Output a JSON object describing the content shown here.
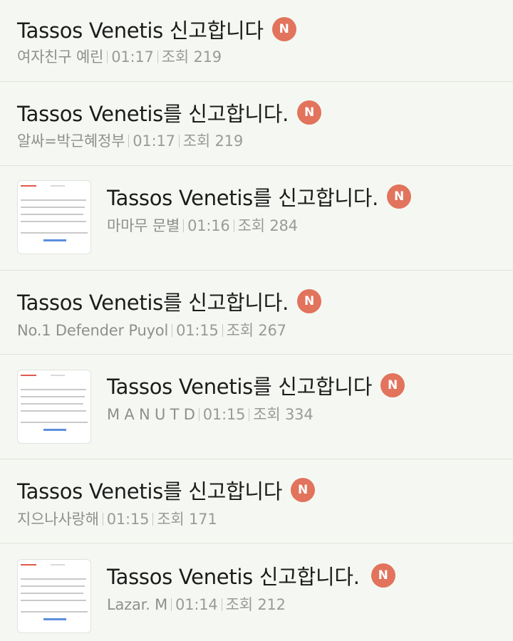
{
  "posts": [
    {
      "title": "Tassos Venetis 신고합니다",
      "badge": "N",
      "author": "여자친구 예린",
      "time": "01:17",
      "views_label": "조회",
      "views": "219",
      "has_thumbnail": false
    },
    {
      "title": "Tassos Venetis를 신고합니다.",
      "badge": "N",
      "author": "알싸=박근혜정부",
      "time": "01:17",
      "views_label": "조회",
      "views": "219",
      "has_thumbnail": false
    },
    {
      "title": "Tassos Venetis를 신고합니다.",
      "badge": "N",
      "author": "마마무 문별",
      "time": "01:16",
      "views_label": "조회",
      "views": "284",
      "has_thumbnail": true
    },
    {
      "title": "Tassos Venetis를 신고합니다.",
      "badge": "N",
      "author": "No.1 Defender Puyol",
      "time": "01:15",
      "views_label": "조회",
      "views": "267",
      "has_thumbnail": false
    },
    {
      "title": "Tassos Venetis를 신고합니다",
      "badge": "N",
      "author": "M A N U T D",
      "time": "01:15",
      "views_label": "조회",
      "views": "334",
      "has_thumbnail": true
    },
    {
      "title": "Tassos Venetis를 신고합니다",
      "badge": "N",
      "author": "지으나사랑해",
      "time": "01:15",
      "views_label": "조회",
      "views": "171",
      "has_thumbnail": false
    },
    {
      "title": "Tassos Venetis 신고합니다.",
      "badge": "N",
      "author": "Lazar. M",
      "time": "01:14",
      "views_label": "조회",
      "views": "212",
      "has_thumbnail": true
    }
  ],
  "colors": {
    "background": "#f5f8f2",
    "badge": "#e2735c",
    "meta_text": "#9a9a9a",
    "divider": "#dde2d9"
  }
}
